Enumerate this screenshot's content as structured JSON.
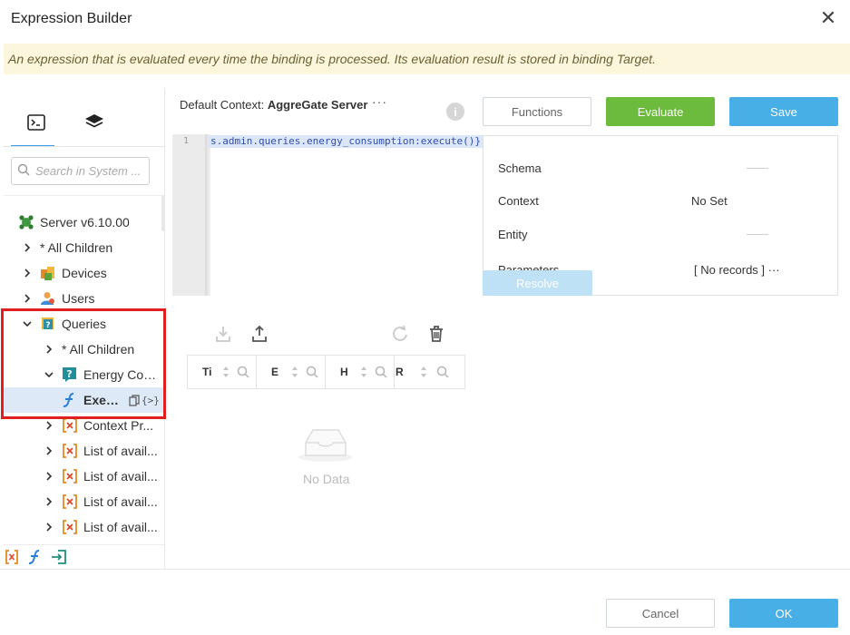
{
  "dialog": {
    "title": "Expression Builder",
    "banner": "An expression that is evaluated every time the binding is processed. Its evaluation result is stored in binding Target."
  },
  "left": {
    "tabs": [
      {
        "icon": "terminal-icon"
      },
      {
        "icon": "layers-icon"
      }
    ],
    "search_placeholder": "Search in System ...",
    "tree": [
      {
        "label": "Server v6.10.00",
        "icon": "server-icon"
      },
      {
        "label": "* All Children"
      },
      {
        "label": "Devices",
        "icon": "devices-icon"
      },
      {
        "label": "Users",
        "icon": "users-icon"
      },
      {
        "label": "Queries",
        "icon": "queries-icon"
      },
      {
        "label": "* All Children"
      },
      {
        "label": "Energy Con...",
        "icon": "query-icon"
      },
      {
        "label": "Exec...",
        "icon": "function-icon",
        "badge": "{>}"
      },
      {
        "label": "Context Pr...",
        "icon": "variable-icon"
      },
      {
        "label": "List of avail...",
        "icon": "variable-icon"
      },
      {
        "label": "List of avail...",
        "icon": "variable-icon"
      },
      {
        "label": "List of avail...",
        "icon": "variable-icon"
      },
      {
        "label": "List of avail...",
        "icon": "variable-icon"
      }
    ]
  },
  "center": {
    "context_label": "Default Context:",
    "context_value": "AggreGate Server",
    "context_more": "···",
    "info": "i",
    "editor": {
      "line_number": "1",
      "code": "s.admin.queries.energy_consumption:execute()}"
    },
    "table": {
      "columns": [
        "Ti",
        "E",
        "H",
        "R"
      ]
    },
    "no_data": "No Data"
  },
  "right": {
    "functions_label": "Functions",
    "evaluate_label": "Evaluate",
    "save_label": "Save",
    "properties": [
      {
        "key": "Schema",
        "value": ""
      },
      {
        "key": "Context",
        "value": "No Set"
      },
      {
        "key": "Entity",
        "value": ""
      },
      {
        "key": "Parameters",
        "value": "[ No records ] ···"
      }
    ],
    "resolve_label": "Resolve"
  },
  "footer": {
    "cancel_label": "Cancel",
    "ok_label": "OK"
  },
  "colors": {
    "accent_blue": "#47aee6",
    "evaluate_green": "#6cbb3c",
    "banner_bg": "#fcf7dc",
    "highlight_red": "#e02020",
    "selection_bg": "#dde9f6"
  }
}
